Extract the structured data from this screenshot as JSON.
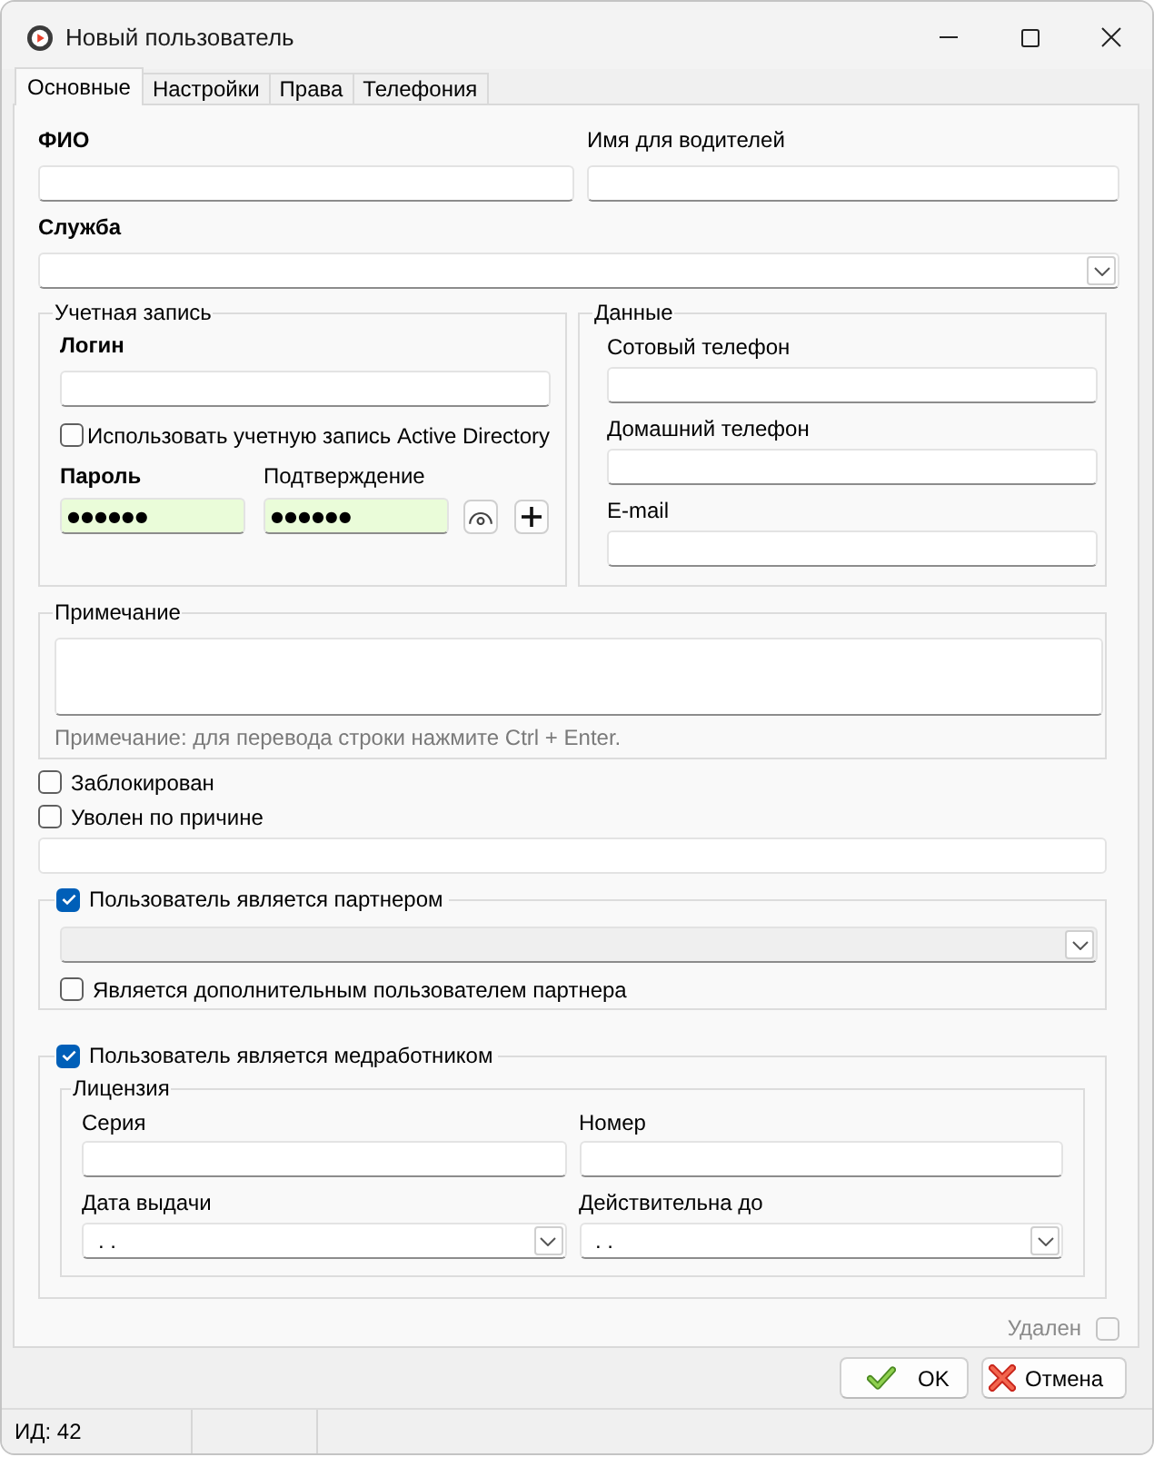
{
  "window": {
    "title": "Новый пользователь"
  },
  "tabs": [
    {
      "label": "Основные",
      "selected": true
    },
    {
      "label": "Настройки",
      "selected": false
    },
    {
      "label": "Права",
      "selected": false
    },
    {
      "label": "Телефония",
      "selected": false
    }
  ],
  "name_fields": [
    {
      "label": "ФИО",
      "required": true
    },
    {
      "label": "Имя для водителей",
      "required": false
    }
  ],
  "service": {
    "label": "Служба",
    "required": true
  },
  "account": {
    "legend": "Учетная запись",
    "login": {
      "label": "Логин",
      "required": true
    },
    "active_directory": {
      "label": "Использовать учетную запись Active Directory",
      "checked": false
    },
    "passwords": [
      {
        "label": "Пароль",
        "required": true,
        "value": "●●●●●●"
      },
      {
        "label": "Подтверждение",
        "required": false,
        "value": "●●●●●●"
      }
    ]
  },
  "contacts": {
    "legend": "Данные",
    "fields": [
      {
        "label": "Сотовый телефон"
      },
      {
        "label": "Домашний телефон"
      },
      {
        "label": "E-mail"
      }
    ]
  },
  "note": {
    "legend": "Примечание",
    "hint": "Примечание: для перевода строки нажмите Ctrl + Enter."
  },
  "flags": [
    {
      "label": "Заблокирован",
      "checked": false
    },
    {
      "label": "Уволен по причине",
      "checked": false
    }
  ],
  "dismissal_reason": {
    "disabled": true
  },
  "partner": {
    "label": "Пользователь является партнером",
    "checked": true,
    "combo": {
      "disabled": true
    },
    "additional": {
      "label": "Является дополнительным пользователем партнера",
      "checked": false
    }
  },
  "medic": {
    "label": "Пользователь является медработником",
    "checked": true,
    "license": {
      "legend": "Лицензия",
      "fields": [
        {
          "label": "Серия",
          "kind": "text"
        },
        {
          "label": "Номер",
          "kind": "text"
        },
        {
          "label": "Дата выдачи",
          "kind": "date",
          "value": ". ."
        },
        {
          "label": "Действительна до",
          "kind": "date",
          "value": ". ."
        }
      ]
    }
  },
  "deleted": {
    "label": "Удален",
    "checked": false,
    "disabled": true
  },
  "buttons": [
    {
      "label": "OK",
      "kind": "ok"
    },
    {
      "label": "Отмена",
      "kind": "cancel"
    }
  ],
  "status_bar": {
    "id": "ИД: 42"
  }
}
